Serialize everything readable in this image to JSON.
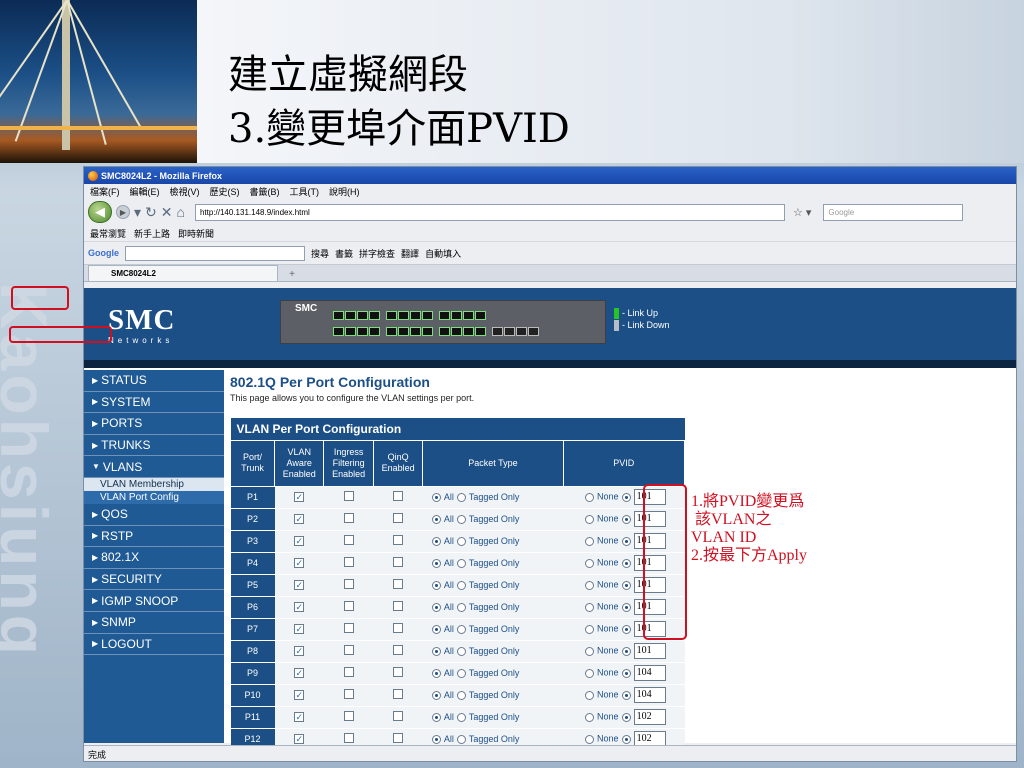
{
  "slide": {
    "title_line1": "建立虛擬網段",
    "title_line2": "3.變更埠介面PVID",
    "side_word": "Kaohsiung",
    "annotation": "1.將PVID變更爲\n 該VLAN之\nVLAN ID\n2.按最下方Apply"
  },
  "browser": {
    "window_title": "SMC8024L2 - Mozilla Firefox",
    "menu": [
      "檔案(F)",
      "編輯(E)",
      "檢視(V)",
      "歷史(S)",
      "書籤(B)",
      "工具(T)",
      "說明(H)"
    ],
    "url": "http://140.131.148.9/index.html",
    "search_placeholder": "Google",
    "bookmarks": [
      "最常瀏覽",
      "新手上路",
      "即時新聞"
    ],
    "toolbar": {
      "logo": "Google",
      "search": "搜尋",
      "bookmarks": "書籤",
      "spell": "拼字檢查",
      "translate": "翻譯",
      "autofill": "自動填入"
    },
    "tab_title": "SMC8024L2",
    "status": "完成"
  },
  "smc": {
    "logo": "SMC",
    "networks": "Networks",
    "switch_name": "SMC",
    "legend_up": "- Link Up",
    "legend_down": "- Link Down",
    "colors": {
      "link_up": "#27c427",
      "link_down": "#b7bcc6"
    }
  },
  "nav": {
    "items": [
      "STATUS",
      "SYSTEM",
      "PORTS",
      "TRUNKS",
      "VLANS",
      "QOS",
      "RSTP",
      "802.1X",
      "SECURITY",
      "IGMP SNOOP",
      "SNMP",
      "LOGOUT"
    ],
    "vlan_sub": [
      "VLAN Membership",
      "VLAN Port Config"
    ]
  },
  "config": {
    "title": "802.1Q Per Port Configuration",
    "desc": "This page allows you to configure the VLAN settings per port.",
    "table_caption": "VLAN Per Port Configuration",
    "headers": {
      "port": [
        "Port/",
        "Trunk"
      ],
      "aware": [
        "VLAN",
        "Aware",
        "Enabled"
      ],
      "ingress": [
        "Ingress",
        "Filtering",
        "Enabled"
      ],
      "qinq": [
        "QinQ",
        "Enabled"
      ],
      "packet": "Packet Type",
      "pvid": "PVID"
    },
    "opt_all": "All",
    "opt_tagged": "Tagged Only",
    "opt_none": "None",
    "rows": [
      {
        "port": "P1",
        "pvid": "101"
      },
      {
        "port": "P2",
        "pvid": "101"
      },
      {
        "port": "P3",
        "pvid": "101"
      },
      {
        "port": "P4",
        "pvid": "101"
      },
      {
        "port": "P5",
        "pvid": "101"
      },
      {
        "port": "P6",
        "pvid": "101"
      },
      {
        "port": "P7",
        "pvid": "101"
      },
      {
        "port": "P8",
        "pvid": "101"
      },
      {
        "port": "P9",
        "pvid": "104"
      },
      {
        "port": "P10",
        "pvid": "104"
      },
      {
        "port": "P11",
        "pvid": "102"
      },
      {
        "port": "P12",
        "pvid": "102"
      }
    ]
  }
}
